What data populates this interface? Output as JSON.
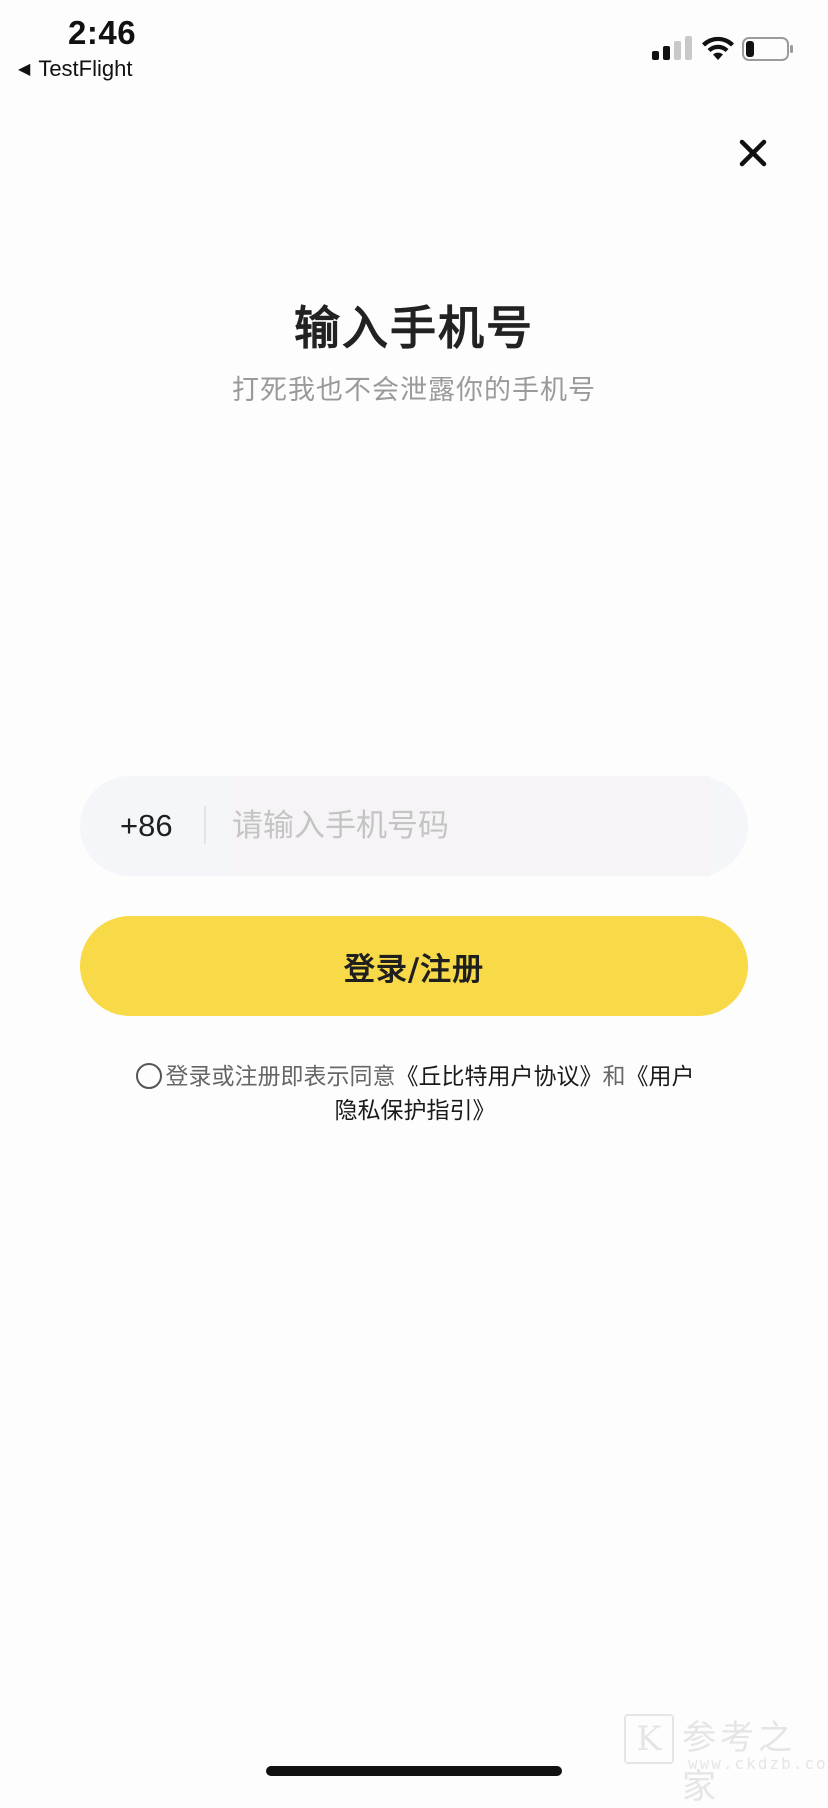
{
  "status_bar": {
    "time": "2:46",
    "back_app": "TestFlight",
    "back_arrow": "◀",
    "signal_bars_active": 2,
    "signal_bars_total": 4
  },
  "header": {
    "title": "输入手机号",
    "subtitle": "打死我也不会泄露你的手机号"
  },
  "phone": {
    "country_code": "+86",
    "placeholder": "请输入手机号码",
    "value": ""
  },
  "login_button": {
    "label": "登录/注册",
    "color": "#f8da48"
  },
  "agreement": {
    "prefix": "登录或注册即表示同意",
    "user_agreement": "《丘比特用户协议》",
    "conjunction": "和",
    "privacy_policy": "《用户隐私保护指引》",
    "checked": false
  },
  "watermark": {
    "logo_letter": "K",
    "name": "参考之家",
    "url": "www.ckdzb.com"
  },
  "icons": {
    "close": "close-icon",
    "wifi": "wifi-icon",
    "battery": "battery-icon",
    "signal": "signal-icon",
    "radio": "radio-icon"
  }
}
